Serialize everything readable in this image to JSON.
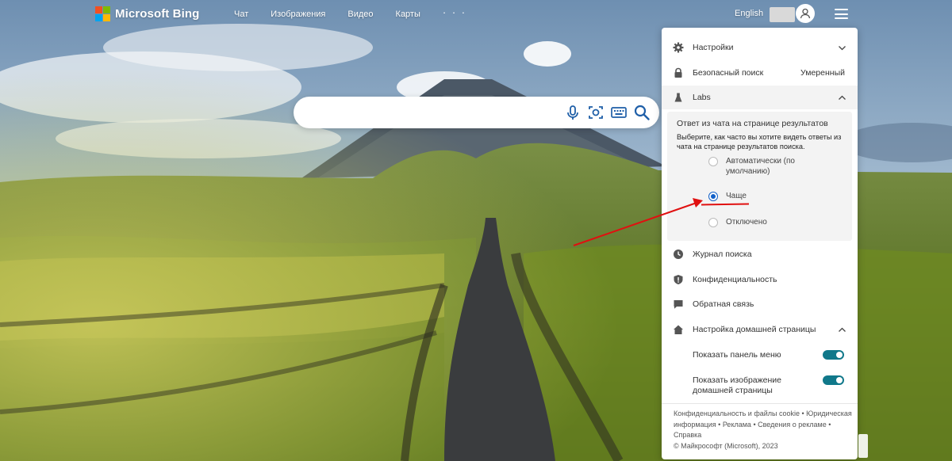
{
  "header": {
    "brand": "Microsoft Bing",
    "nav": [
      {
        "label": "Чат"
      },
      {
        "label": "Изображения"
      },
      {
        "label": "Видео"
      },
      {
        "label": "Карты"
      }
    ],
    "more": "· · ·",
    "language": "English"
  },
  "search": {
    "placeholder": "",
    "value": ""
  },
  "settings": {
    "settings_label": "Настройки",
    "safesearch_label": "Безопасный поиск",
    "safesearch_value": "Умеренный",
    "labs_label": "Labs",
    "labs_section": {
      "title": "Ответ из чата на странице результатов",
      "description": "Выберите, как часто вы хотите видеть ответы из чата на странице результатов поиска.",
      "options": [
        {
          "label": "Автоматически (по умолчанию)",
          "selected": false
        },
        {
          "label": "Чаще",
          "selected": true
        },
        {
          "label": "Отключено",
          "selected": false
        }
      ]
    },
    "history_label": "Журнал поиска",
    "privacy_label": "Конфиденциальность",
    "feedback_label": "Обратная связь",
    "homepage_label": "Настройка домашней страницы",
    "toggles": [
      {
        "label": "Показать панель меню",
        "on": true
      },
      {
        "label": "Показать изображение домашней страницы",
        "on": true
      }
    ],
    "footer": {
      "links": [
        "Конфиденциальность и файлы cookie",
        "Юридическая информация",
        "Реклама",
        "Сведения о рекламе",
        "Справка"
      ],
      "copyright": "© Майкрософт (Microsoft), 2023"
    }
  },
  "colors": {
    "toggle_on": "#10788a",
    "radio_selected": "#1160c8",
    "annotation_red": "#e01010"
  }
}
